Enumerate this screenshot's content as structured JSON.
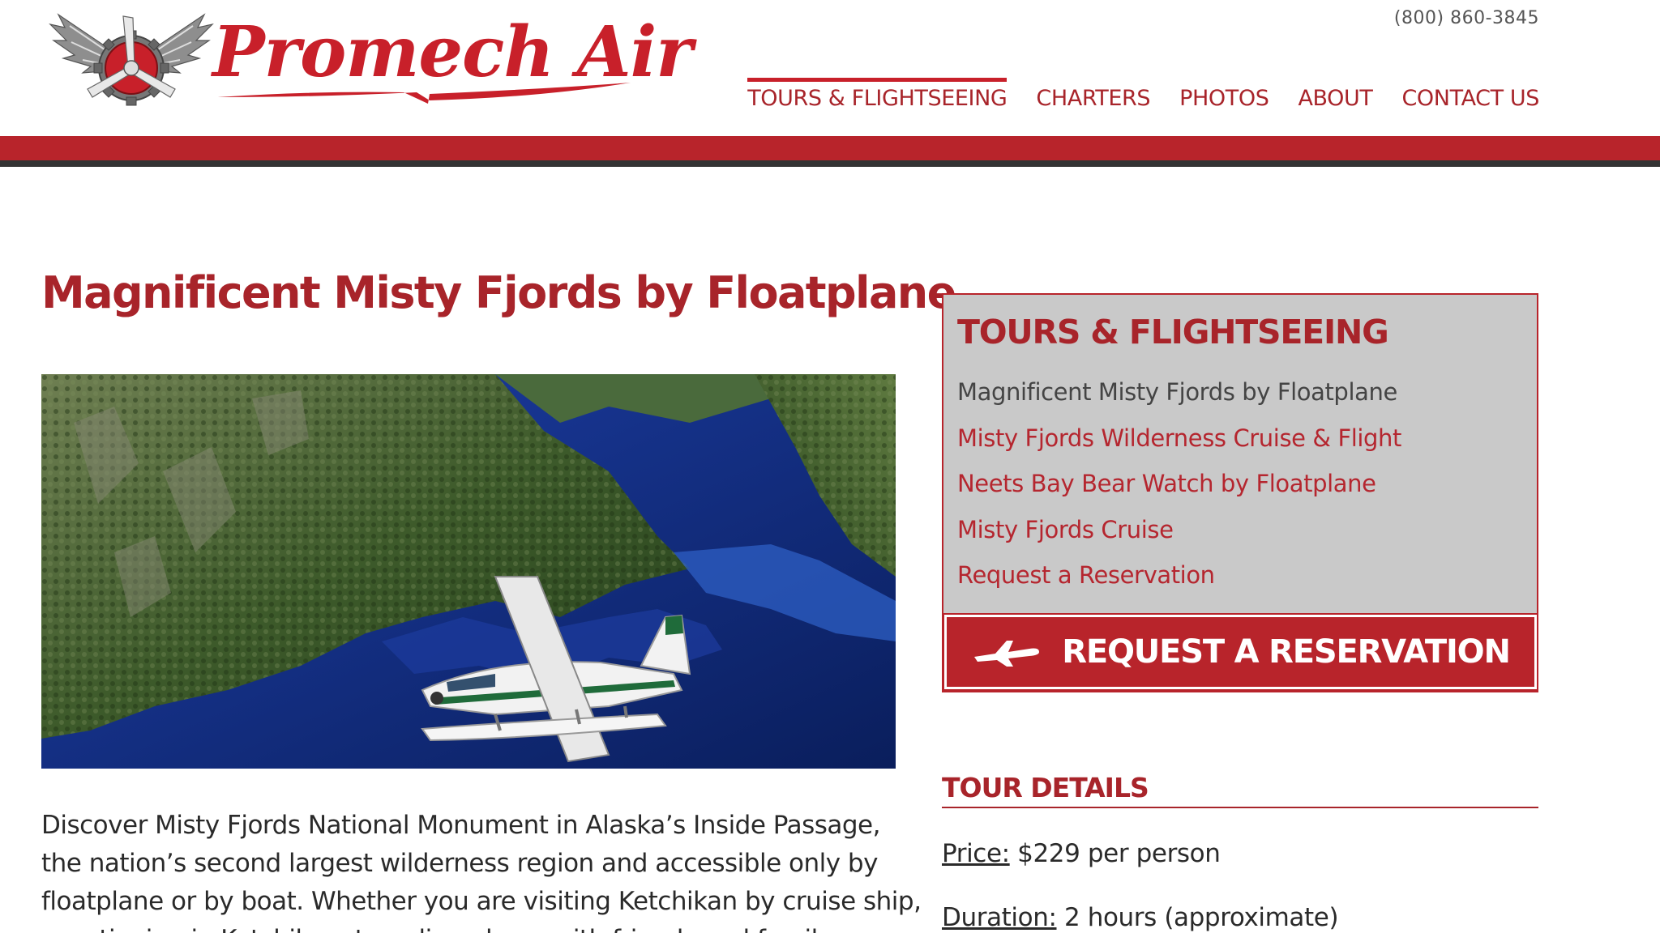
{
  "brand": {
    "name": "Promech Air",
    "phone": "(800) 860-3845"
  },
  "nav": {
    "items": [
      {
        "label": "TOURS & FLIGHTSEEING",
        "active": true
      },
      {
        "label": "CHARTERS",
        "active": false
      },
      {
        "label": "PHOTOS",
        "active": false
      },
      {
        "label": "ABOUT",
        "active": false
      },
      {
        "label": "CONTACT US",
        "active": false
      }
    ]
  },
  "colors": {
    "accent": "#b8242b",
    "accent_text": "#a8242a",
    "band_dark": "#333333",
    "sidebar_bg": "#c9c9c9"
  },
  "main": {
    "title": "Magnificent Misty Fjords by Floatplane",
    "intro_lines": [
      "Discover Misty Fjords National Monument in Alaska’s Inside Passage,",
      "the nation’s second largest wilderness region and accessible only by",
      "floatplane or by boat. Whether you are visiting Ketchikan by cruise ship,",
      "vacationing in Ketchikan, traveling alone, with friends and family, or on"
    ]
  },
  "sidebar": {
    "title": "TOURS & FLIGHTSEEING",
    "links": [
      {
        "label": "Magnificent Misty Fjords by Floatplane",
        "current": true
      },
      {
        "label": "Misty Fjords Wilderness Cruise & Flight",
        "current": false
      },
      {
        "label": "Neets Bay Bear Watch by Floatplane",
        "current": false
      },
      {
        "label": "Misty Fjords Cruise",
        "current": false
      },
      {
        "label": "Request a Reservation",
        "current": false
      }
    ],
    "reserve_button": {
      "label": "REQUEST A RESERVATION",
      "icon": "airplane-icon"
    }
  },
  "details": {
    "title": "TOUR DETAILS",
    "price_label": "Price:",
    "price_value": "$229 per person",
    "duration_label": "Duration:",
    "duration_value": "2 hours (approximate)"
  }
}
